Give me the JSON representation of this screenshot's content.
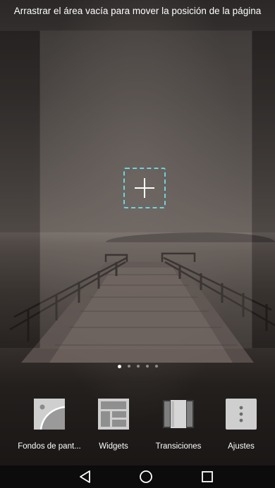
{
  "hint": {
    "text": "Arrastrar el área vacía para mover la posición de la página"
  },
  "pages": {
    "count": 5,
    "active_index": 0
  },
  "add_page": {
    "icon": "plus-icon",
    "accent_color": "#6fd3dc"
  },
  "toolbar": {
    "items": [
      {
        "label": "Fondos de pant...",
        "icon": "wallpaper-icon"
      },
      {
        "label": "Widgets",
        "icon": "widgets-icon"
      },
      {
        "label": "Transiciones",
        "icon": "transitions-icon"
      },
      {
        "label": "Ajustes",
        "icon": "settings-dots-icon"
      }
    ]
  },
  "navbar": {
    "buttons": [
      {
        "icon": "back-triangle-icon"
      },
      {
        "icon": "home-circle-icon"
      },
      {
        "icon": "recents-square-icon"
      }
    ]
  }
}
